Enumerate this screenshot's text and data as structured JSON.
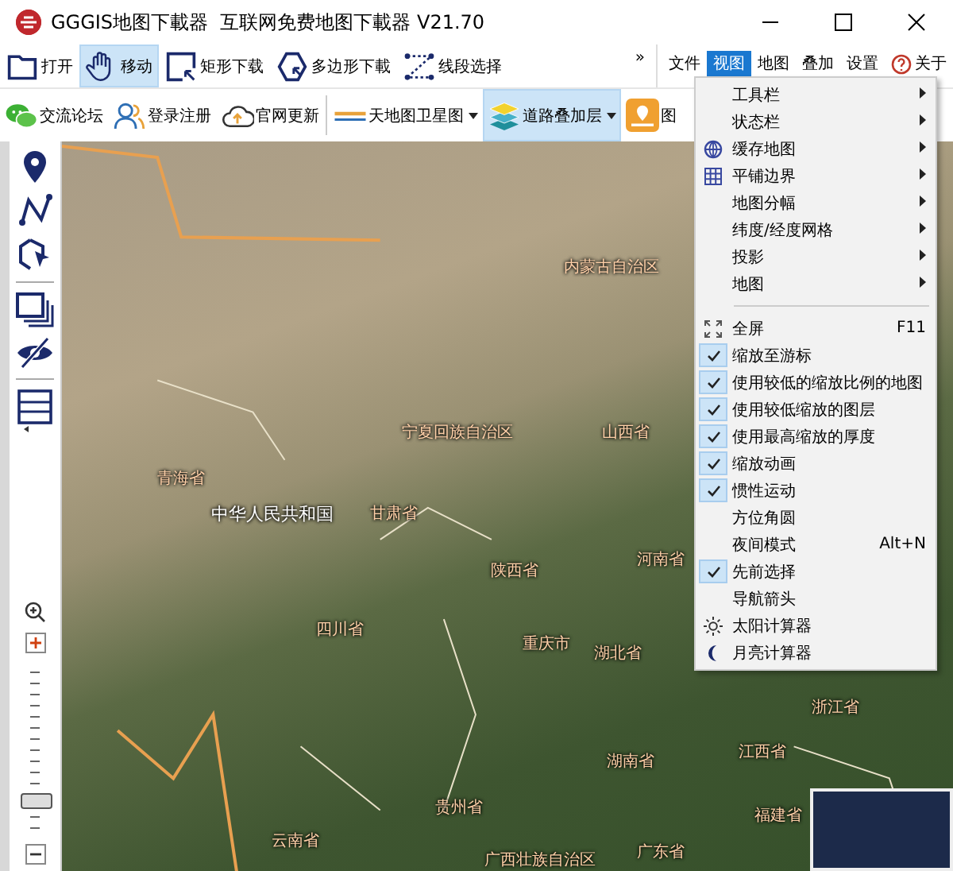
{
  "window": {
    "title": "GGGIS地图下載器  互联网免费地图下載器 V21.70"
  },
  "toolbar": [
    {
      "label": "打开",
      "selected": false
    },
    {
      "label": "移动",
      "selected": true
    },
    {
      "label": "矩形下载",
      "selected": false
    },
    {
      "label": "多边形下載",
      "selected": false
    },
    {
      "label": "线段选择",
      "selected": false
    }
  ],
  "toolbar_overflow": "»",
  "menubar": [
    {
      "label": "文件",
      "selected": false
    },
    {
      "label": "视图",
      "selected": true
    },
    {
      "label": "地图",
      "selected": false
    },
    {
      "label": "叠加",
      "selected": false
    },
    {
      "label": "设置",
      "selected": false
    },
    {
      "label": "关于",
      "selected": false
    }
  ],
  "toolbar2": [
    {
      "label": "交流论坛",
      "dropdown": false,
      "selected": false
    },
    {
      "label": "登录注册",
      "dropdown": false,
      "selected": false
    },
    {
      "label": "官网更新",
      "dropdown": false,
      "selected": false
    },
    {
      "label": "天地图卫星图",
      "dropdown": true,
      "selected": false
    },
    {
      "label": "道路叠加层",
      "dropdown": true,
      "selected": true
    },
    {
      "label": "图",
      "dropdown": false,
      "selected": false
    }
  ],
  "zoom": {
    "level": 0.18
  },
  "map_labels": [
    {
      "text": "内蒙古自治区",
      "kind": "province"
    },
    {
      "text": "宁夏回族自治区",
      "kind": "province"
    },
    {
      "text": "山西省",
      "kind": "province"
    },
    {
      "text": "青海省",
      "kind": "province"
    },
    {
      "text": "中华人民共和国",
      "kind": "country"
    },
    {
      "text": "甘肃省",
      "kind": "province"
    },
    {
      "text": "陕西省",
      "kind": "province"
    },
    {
      "text": "河南省",
      "kind": "province"
    },
    {
      "text": "四川省",
      "kind": "province"
    },
    {
      "text": "重庆市",
      "kind": "province"
    },
    {
      "text": "湖北省",
      "kind": "province"
    },
    {
      "text": "浙江省",
      "kind": "province"
    },
    {
      "text": "湖南省",
      "kind": "province"
    },
    {
      "text": "江西省",
      "kind": "province"
    },
    {
      "text": "贵州省",
      "kind": "province"
    },
    {
      "text": "福建省",
      "kind": "province"
    },
    {
      "text": "云南省",
      "kind": "province"
    },
    {
      "text": "广西壮族自治区",
      "kind": "province"
    },
    {
      "text": "广东省",
      "kind": "province"
    }
  ],
  "view_menu": [
    {
      "kind": "submenu",
      "label": "工具栏",
      "checked": false
    },
    {
      "kind": "submenu",
      "label": "状态栏",
      "checked": false
    },
    {
      "kind": "submenu",
      "label": "缓存地图",
      "checked": false
    },
    {
      "kind": "submenu",
      "label": "平铺边界",
      "checked": false
    },
    {
      "kind": "submenu",
      "label": "地图分幅",
      "checked": false
    },
    {
      "kind": "submenu",
      "label": "纬度/经度网格",
      "checked": false
    },
    {
      "kind": "submenu",
      "label": "投影",
      "checked": false
    },
    {
      "kind": "submenu",
      "label": "地图",
      "checked": false
    },
    {
      "kind": "separator"
    },
    {
      "kind": "item",
      "label": "全屏",
      "checked": false,
      "shortcut": "F11"
    },
    {
      "kind": "item",
      "label": "缩放至游标",
      "checked": true
    },
    {
      "kind": "item",
      "label": "使用较低的缩放比例的地图",
      "checked": true
    },
    {
      "kind": "item",
      "label": "使用较低缩放的图层",
      "checked": true
    },
    {
      "kind": "item",
      "label": "使用最高缩放的厚度",
      "checked": true
    },
    {
      "kind": "item",
      "label": "缩放动画",
      "checked": true
    },
    {
      "kind": "item",
      "label": "惯性运动",
      "checked": true
    },
    {
      "kind": "item",
      "label": "方位角圆",
      "checked": false
    },
    {
      "kind": "item",
      "label": "夜间模式",
      "checked": false,
      "shortcut": "Alt+N"
    },
    {
      "kind": "item",
      "label": "先前选择",
      "checked": true
    },
    {
      "kind": "item",
      "label": "导航箭头",
      "checked": false
    },
    {
      "kind": "item",
      "label": "太阳计算器",
      "checked": false
    },
    {
      "kind": "item",
      "label": "月亮计算器",
      "checked": false
    }
  ]
}
